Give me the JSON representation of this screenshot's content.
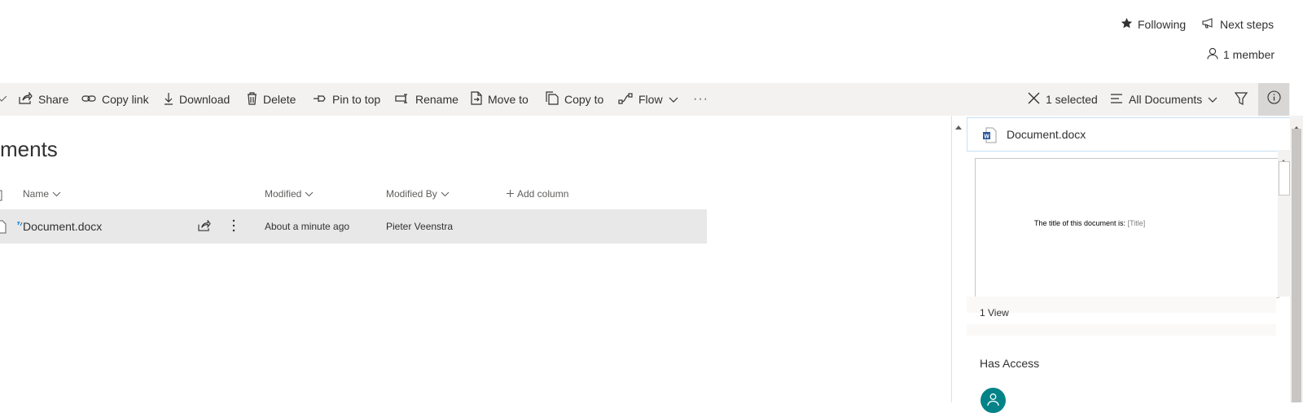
{
  "header": {
    "following_label": "Following",
    "next_steps_label": "Next steps",
    "members_label": "1 member"
  },
  "commandbar": {
    "items": [
      {
        "label": "Share",
        "icon": "share-icon"
      },
      {
        "label": "Copy link",
        "icon": "link-icon"
      },
      {
        "label": "Download",
        "icon": "download-icon"
      },
      {
        "label": "Delete",
        "icon": "trash-icon"
      },
      {
        "label": "Pin to top",
        "icon": "pin-icon"
      },
      {
        "label": "Rename",
        "icon": "rename-icon"
      },
      {
        "label": "Move to",
        "icon": "move-icon"
      },
      {
        "label": "Copy to",
        "icon": "copy-icon"
      },
      {
        "label": "Flow",
        "icon": "flow-icon"
      }
    ],
    "more_label": "···",
    "selected_label": "1 selected",
    "view_label": "All Documents"
  },
  "library": {
    "title": "ments",
    "columns": {
      "name": "Name",
      "modified": "Modified",
      "modified_by": "Modified By",
      "add_column": "Add column"
    },
    "rows": [
      {
        "name": "Document.docx",
        "modified": "About a minute ago",
        "modified_by": "Pieter Veenstra"
      }
    ]
  },
  "details_pane": {
    "file_name": "Document.docx",
    "preview_text": "The title of this document is:",
    "preview_placeholder": "[Title]",
    "views": "1 View",
    "has_access_title": "Has Access"
  },
  "colors": {
    "accent": "#0078d4",
    "commandbar_bg": "#f3f2f1",
    "selected_row": "#e8e8e8",
    "avatar": "#038387",
    "word_blue": "#2b579a"
  }
}
